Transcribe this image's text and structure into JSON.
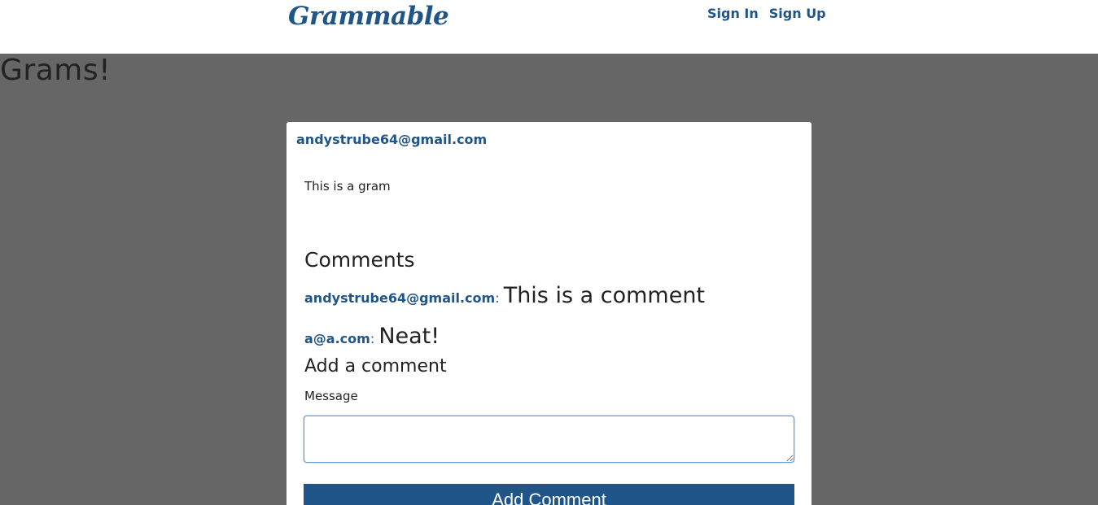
{
  "nav": {
    "brand": "Grammable",
    "links": [
      "Sign In",
      "Sign Up"
    ]
  },
  "page": {
    "title": "Grams!"
  },
  "gram": {
    "author": "andystrube64@gmail.com",
    "caption": "This is a gram",
    "comments_heading": "Comments",
    "comments": [
      {
        "user": "andystrube64@gmail.com",
        "text": "This is a comment"
      },
      {
        "user": "a@a.com",
        "text": "Neat!"
      }
    ],
    "add_comment_heading": "Add a comment",
    "message_label": "Message",
    "message_value": "",
    "submit_label": "Add Comment"
  },
  "colors": {
    "brand": "#20558a",
    "background": "#666666",
    "card": "#ffffff"
  }
}
